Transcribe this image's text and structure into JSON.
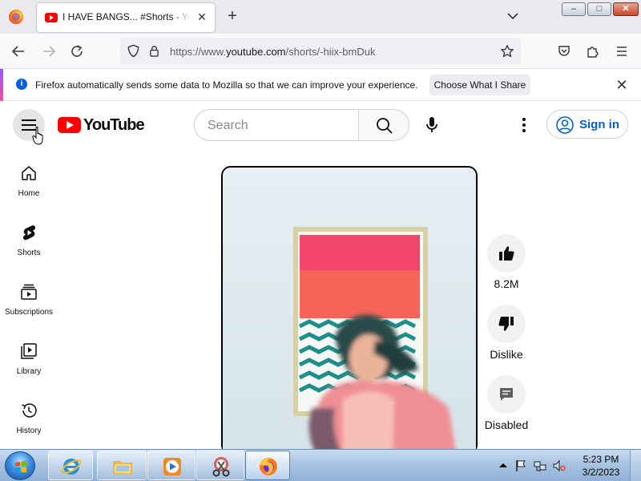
{
  "browser": {
    "tab": {
      "title": "I HAVE BANGS... #Shorts - YouTube"
    },
    "url": {
      "prefix": "https://www.",
      "domain": "youtube.com",
      "path": "/shorts/-hiix-bmDuk"
    },
    "notification": {
      "text": "Firefox automatically sends some data to Mozilla so that we can improve your experience.",
      "button": "Choose What I Share"
    },
    "window_buttons": {
      "minimize": "–",
      "maximize": "□",
      "close": "✕"
    }
  },
  "youtube": {
    "logo_text": "YouTube",
    "search": {
      "placeholder": "Search"
    },
    "signin": "Sign in",
    "sidebar": [
      {
        "label": "Home",
        "icon": "home-icon"
      },
      {
        "label": "Shorts",
        "icon": "shorts-icon"
      },
      {
        "label": "Subscriptions",
        "icon": "subscriptions-icon"
      },
      {
        "label": "Library",
        "icon": "library-icon"
      },
      {
        "label": "History",
        "icon": "history-icon"
      }
    ],
    "actions": {
      "like": "8.2M",
      "dislike": "Dislike",
      "comments": "Disabled"
    }
  },
  "taskbar": {
    "time": "5:23 PM",
    "date": "3/2/2023",
    "apps": [
      "internet-explorer",
      "windows-explorer",
      "media-player",
      "snipping-tool",
      "firefox"
    ]
  },
  "colors": {
    "yt_red": "#ff0000",
    "signin_blue": "#065fd4",
    "taskbar": "#a9c4e2"
  }
}
